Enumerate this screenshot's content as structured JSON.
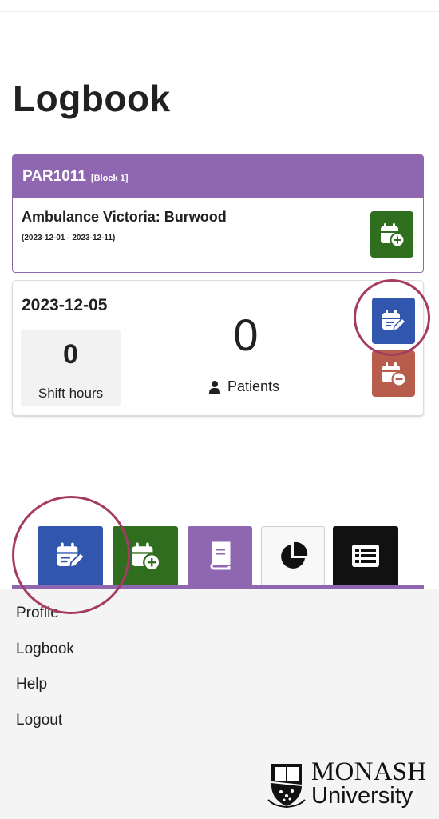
{
  "page": {
    "title": "Logbook"
  },
  "block": {
    "code": "PAR1011",
    "tag": "[Block 1]",
    "place": "Ambulance Victoria: Burwood",
    "dates": "(2023-12-01 - 2023-12-11)"
  },
  "shift": {
    "date": "2023-12-05",
    "hours_value": "0",
    "hours_label": "Shift hours",
    "patients_value": "0",
    "patients_label": "Patients"
  },
  "footer": {
    "links": [
      "Profile",
      "Logbook",
      "Help",
      "Logout"
    ],
    "logo_name": "MONASH",
    "logo_sub": "University"
  },
  "colors": {
    "purple": "#8f66b0",
    "green": "#2f6e1f",
    "blue": "#3156ad",
    "red": "#b85c4c",
    "highlight_circle": "#a53a63"
  }
}
